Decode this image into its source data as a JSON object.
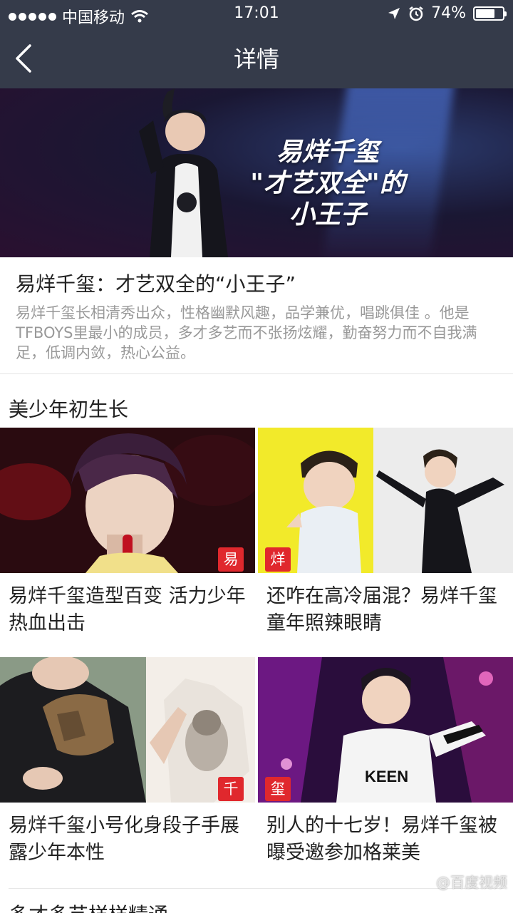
{
  "status_bar": {
    "carrier": "中国移动",
    "time": "17:01",
    "battery": "74%",
    "battery_level": 0.74
  },
  "nav": {
    "title": "详情"
  },
  "hero": {
    "line1": "易烊千玺",
    "line2": "\"才艺双全\"的",
    "line3": "小王子"
  },
  "intro": {
    "title": "易烊千玺：才艺双全的“小王子”",
    "description": "易烊千玺长相清秀出众，性格幽默风趣，品学兼优，唱跳俱佳 。他是TFBOYS里最小的成员，多才多艺而不张扬炫耀，勤奋努力而不自我满足，低调内敛，热心公益。"
  },
  "section": {
    "title": "美少年初生长"
  },
  "cards": [
    {
      "badge": "易",
      "caption": "易烊千玺造型百变 活力少年热血出击"
    },
    {
      "badge": "烊",
      "caption": "还咋在高冷届混？易烊千玺童年照辣眼睛"
    },
    {
      "badge": "千",
      "caption": "易烊千玺小号化身段子手展露少年本性"
    },
    {
      "badge": "玺",
      "caption": "别人的十七岁！易烊千玺被曝受邀参加格莱美"
    }
  ],
  "next_section": {
    "title": "多才多艺样样精通"
  },
  "watermark": "@百度视频",
  "colors": {
    "nav_bg": "#353b4a",
    "badge": "#e0282d"
  }
}
